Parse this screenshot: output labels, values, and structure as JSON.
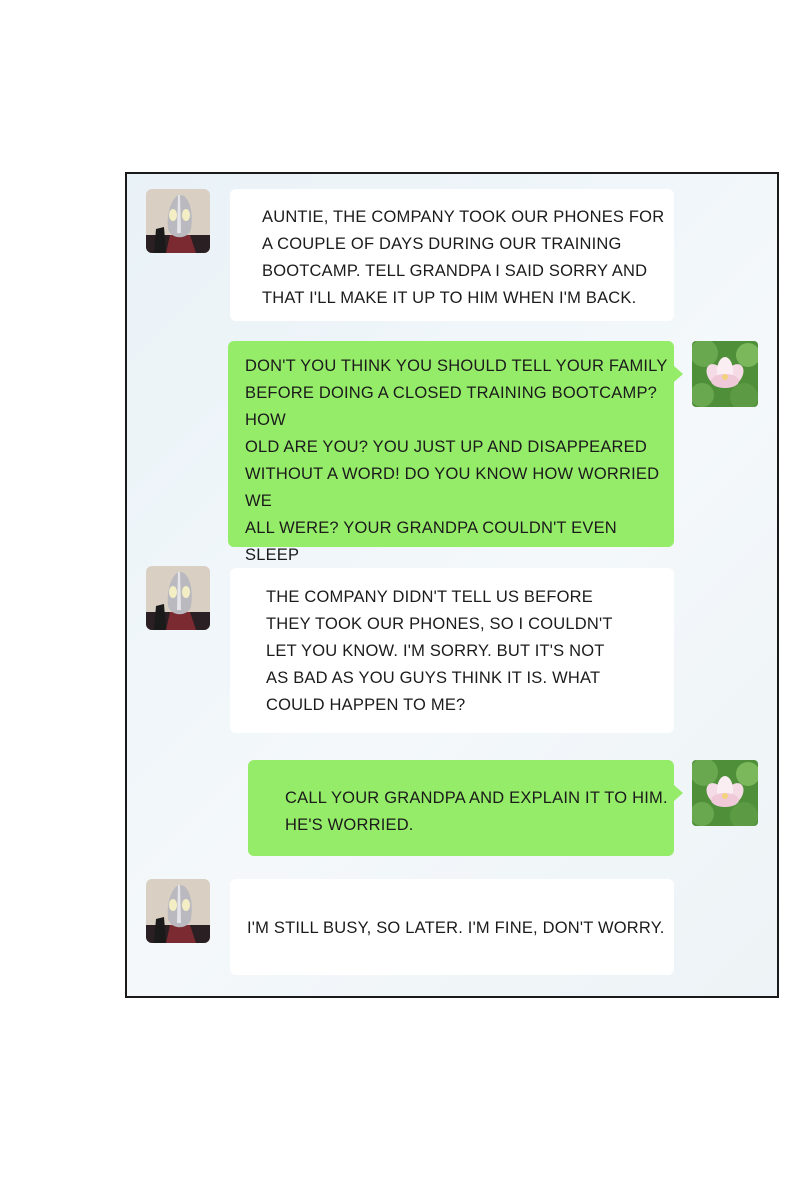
{
  "chat": {
    "messages": [
      {
        "sender": "nephew",
        "text": "AUNTIE, THE COMPANY TOOK OUR PHONES FOR\nA COUPLE OF DAYS DURING OUR TRAINING\nBOOTCAMP. TELL GRANDPA I SAID SORRY AND\nTHAT I'LL MAKE IT UP TO HIM WHEN I'M BACK."
      },
      {
        "sender": "auntie",
        "text": "DON'T YOU THINK YOU SHOULD TELL YOUR FAMILY\nBEFORE DOING A CLOSED TRAINING BOOTCAMP? HOW\nOLD ARE YOU? YOU JUST UP AND DISAPPEARED\nWITHOUT A WORD! DO YOU KNOW HOW WORRIED WE\nALL WERE? YOUR GRANDPA COULDN'T EVEN SLEEP\nTHESE PAST FEW DAYS BECAUSE HE THOUGHT\nSOMETHING BAD HAPPENED TO YOU!"
      },
      {
        "sender": "nephew",
        "text": "THE COMPANY DIDN'T TELL US BEFORE\nTHEY TOOK OUR PHONES, SO I COULDN'T\nLET YOU KNOW. I'M SORRY. BUT IT'S NOT\nAS BAD AS YOU GUYS THINK IT IS. WHAT\nCOULD HAPPEN TO ME?"
      },
      {
        "sender": "auntie",
        "text": "CALL YOUR GRANDPA AND EXPLAIN IT TO HIM.\nHE'S WORRIED."
      },
      {
        "sender": "nephew",
        "text": "I'M STILL BUSY, SO LATER. I'M FINE, DON'T WORRY."
      }
    ],
    "avatars": {
      "nephew": "masked-hero-avatar",
      "auntie": "lotus-flower-avatar"
    }
  },
  "colors": {
    "sent_bubble": "#95ec69",
    "received_bubble": "#ffffff",
    "frame_border": "#1a1a1a"
  }
}
